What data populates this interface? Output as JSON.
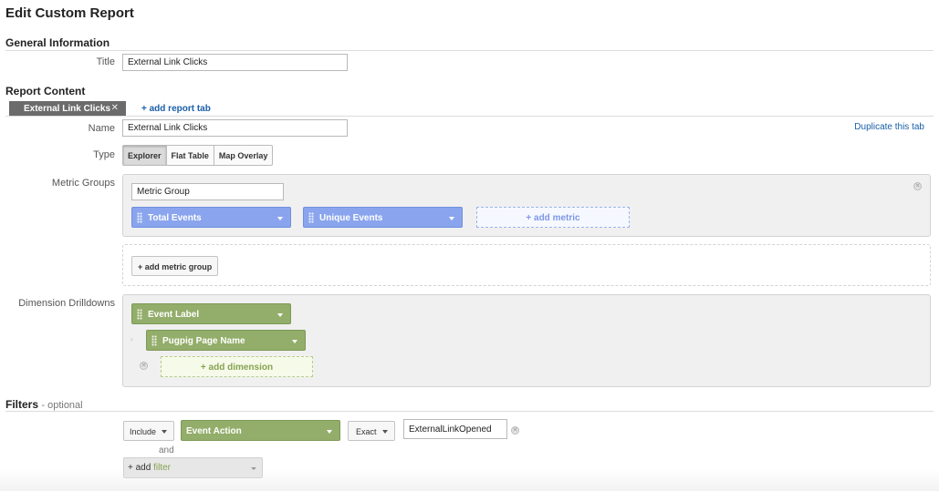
{
  "page": {
    "title": "Edit Custom Report"
  },
  "general": {
    "heading": "General Information",
    "title_label": "Title",
    "title_value": "External Link Clicks"
  },
  "content": {
    "heading": "Report Content",
    "tabs": [
      {
        "label": "External Link Clicks",
        "close": "✕"
      }
    ],
    "add_tab_label": "+ add report tab",
    "name_label": "Name",
    "name_value": "External Link Clicks",
    "duplicate_label": "Duplicate this tab",
    "type_label": "Type",
    "type_options": [
      "Explorer",
      "Flat Table",
      "Map Overlay"
    ],
    "type_selected": "Explorer",
    "metric_groups_label": "Metric Groups",
    "metric_group_name": "Metric Group",
    "metrics": [
      "Total Events",
      "Unique Events"
    ],
    "add_metric_label": "+ add metric",
    "add_metric_group_label": "+ add metric group",
    "dimension_label": "Dimension Drilldowns",
    "dimensions": [
      "Event Label",
      "Pugpig Page Name"
    ],
    "add_dimension_label": "+ add dimension"
  },
  "filters": {
    "heading": "Filters",
    "optional": "- optional",
    "include_label": "Include",
    "dimension": "Event Action",
    "match_type": "Exact",
    "value": "ExternalLinkOpened",
    "and_label": "and",
    "add_filter_plus": "+ add",
    "add_filter_word": "filter"
  },
  "colors": {
    "metric_blue": "#8aa5ee",
    "dimension_green": "#93ad6a",
    "link_blue": "#1a5fa8"
  }
}
